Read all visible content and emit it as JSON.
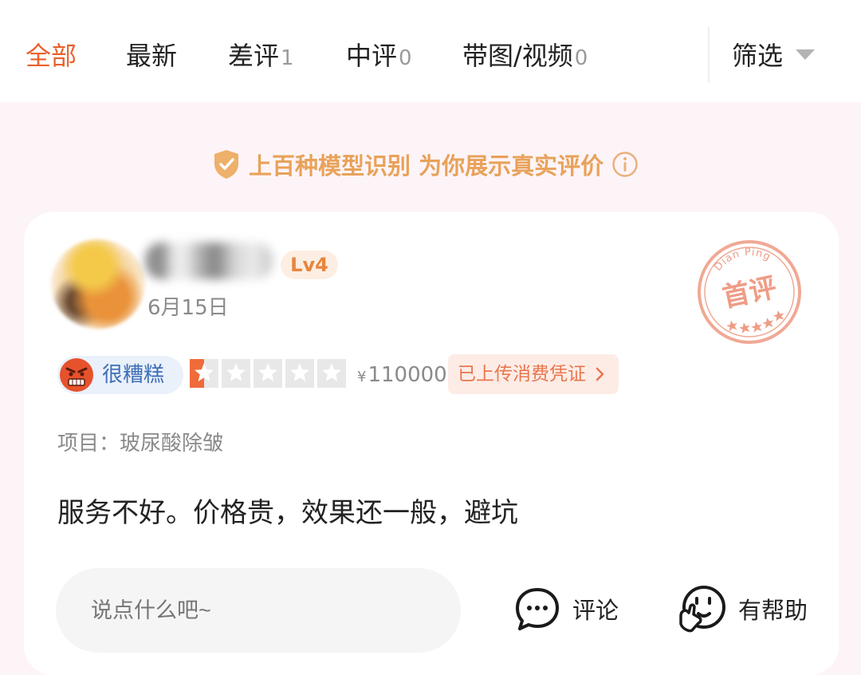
{
  "tabs": [
    {
      "label": "全部",
      "count": "",
      "active": true
    },
    {
      "label": "最新",
      "count": "",
      "active": false
    },
    {
      "label": "差评",
      "count": "1",
      "active": false
    },
    {
      "label": "中评",
      "count": "0",
      "active": false
    },
    {
      "label": "带图/视频",
      "count": "0",
      "active": false
    }
  ],
  "filter": {
    "label": "筛选",
    "icon": "caret-down-icon"
  },
  "notice": {
    "text": "上百种模型识别 为你展示真实评价",
    "icon": "shield-check-icon",
    "info_icon": "info-icon"
  },
  "review": {
    "level": "Lv4",
    "date": "6月15日",
    "stamp": {
      "top": "Dian Ping",
      "main": "首评"
    },
    "sentiment": "很糟糕",
    "rating": {
      "value": 0.5,
      "max": 5
    },
    "price_symbol": "¥",
    "price": "110000",
    "proof_label": "已上传消费凭证",
    "project": "项目：玻尿酸除皱",
    "content": "服务不好。价格贵，效果还一般，避坑"
  },
  "actions": {
    "comment_placeholder": "说点什么吧~",
    "comment_label": "评论",
    "helpful_label": "有帮助"
  },
  "colors": {
    "accent": "#e8622c",
    "notice": "#e8a25a",
    "sentiment_text": "#3f6fb6",
    "star_fill": "#ef6b3a"
  }
}
